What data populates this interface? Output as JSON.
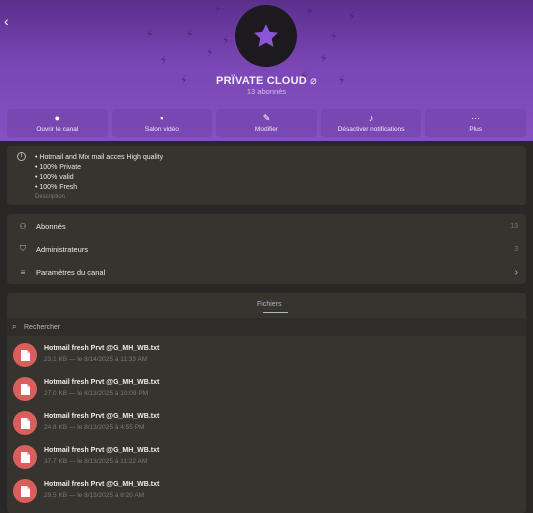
{
  "header": {
    "channel_name": "PRÏVATE CLOUD",
    "subscribers": "13 abonnés"
  },
  "actions": [
    {
      "label": "Ouvrir le canal",
      "icon": "chat-bubble-icon"
    },
    {
      "label": "Salon vidéo",
      "icon": "video-chat-icon"
    },
    {
      "label": "Modifier",
      "icon": "pencil-icon"
    },
    {
      "label": "Désactiver notifications",
      "icon": "bell-icon"
    },
    {
      "label": "Plus",
      "icon": "more-icon"
    }
  ],
  "description": {
    "lines": [
      "• Hotmail and Mix mail acces High quality",
      "• 100% Private",
      "• 100% valid",
      "• 100% Fresh"
    ],
    "caption": "Description"
  },
  "stats": {
    "subscribers_label": "Abonnés",
    "subscribers_value": "13",
    "admins_label": "Administrateurs",
    "admins_value": "3",
    "settings_label": "Paramètres du canal"
  },
  "files": {
    "tab_label": "Fichiers",
    "search_placeholder": "Rechercher",
    "items": [
      {
        "name": "Hotmail fresh Prvt @G_MH_WB.txt",
        "meta": "23.1 KB — le 8/14/2025 à 11:33 AM"
      },
      {
        "name": "Hotmail fresh Prvt @G_MH_WB.txt",
        "meta": "27.0 KB — le 8/13/2025 à 10:09 PM"
      },
      {
        "name": "Hotmail fresh Prvt @G_MH_WB.txt",
        "meta": "24.8 KB — le 8/13/2025 à 4:55 PM"
      },
      {
        "name": "Hotmail fresh Prvt @G_MH_WB.txt",
        "meta": "37.7 KB — le 8/13/2025 à 11:22 AM"
      },
      {
        "name": "Hotmail fresh Prvt @G_MH_WB.txt",
        "meta": "29.5 KB — le 8/13/2025 à 8:20 AM"
      }
    ]
  },
  "colors": {
    "header_purple": "#7a46b5",
    "file_icon_red": "#d95f5c",
    "card_bg": "#37332f"
  }
}
